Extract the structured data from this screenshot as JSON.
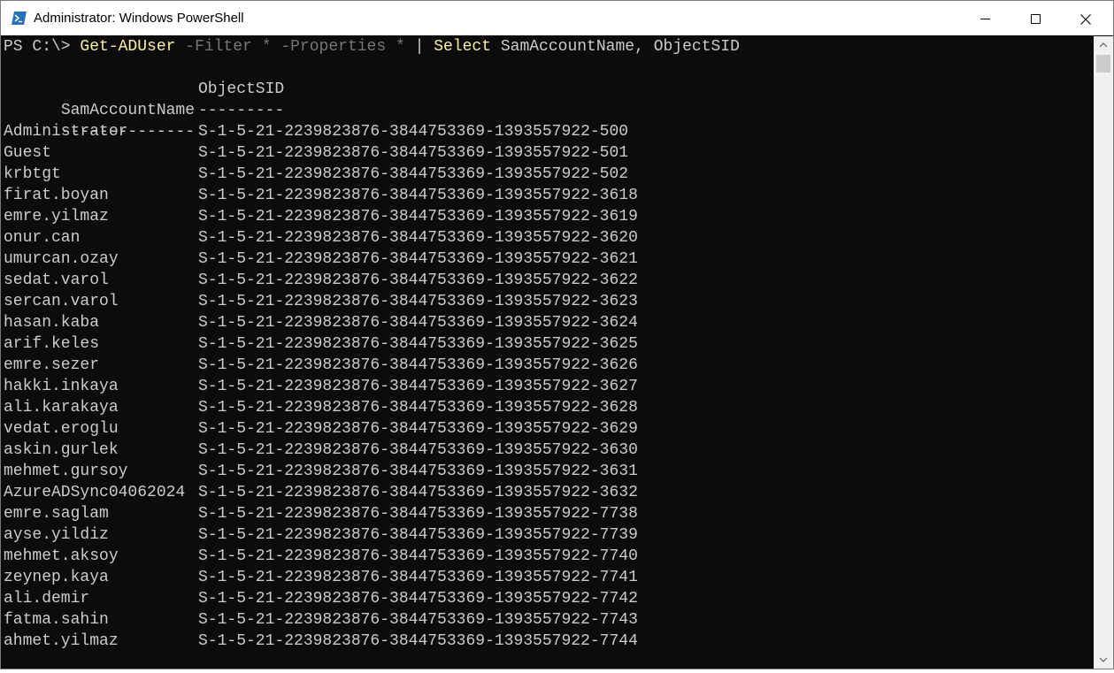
{
  "window": {
    "title": "Administrator: Windows PowerShell",
    "accent_color": "#012456",
    "console_bg": "#0c0c0c",
    "console_fg": "#cccccc",
    "command_color": "#f9f1a5",
    "parameter_color": "#767676"
  },
  "controls": {
    "minimize_icon": "minimize-icon",
    "maximize_icon": "maximize-icon",
    "close_icon": "close-icon"
  },
  "command_line": {
    "prompt": "PS C:\\> ",
    "cmdlet": "Get-ADUser",
    "param_filter": "-Filter",
    "filter_value": "*",
    "param_properties": "-Properties",
    "properties_value": "*",
    "pipe": "|",
    "select_cmd": "Select",
    "select_args": "SamAccountName,",
    "select_args2": "ObjectSID"
  },
  "table": {
    "headers": [
      "SamAccountName",
      "ObjectSID"
    ],
    "separators": [
      "--------------",
      "---------"
    ],
    "rows": [
      [
        "Administrator",
        "S-1-5-21-2239823876-3844753369-1393557922-500"
      ],
      [
        "Guest",
        "S-1-5-21-2239823876-3844753369-1393557922-501"
      ],
      [
        "krbtgt",
        "S-1-5-21-2239823876-3844753369-1393557922-502"
      ],
      [
        "firat.boyan",
        "S-1-5-21-2239823876-3844753369-1393557922-3618"
      ],
      [
        "emre.yilmaz",
        "S-1-5-21-2239823876-3844753369-1393557922-3619"
      ],
      [
        "onur.can",
        "S-1-5-21-2239823876-3844753369-1393557922-3620"
      ],
      [
        "umurcan.ozay",
        "S-1-5-21-2239823876-3844753369-1393557922-3621"
      ],
      [
        "sedat.varol",
        "S-1-5-21-2239823876-3844753369-1393557922-3622"
      ],
      [
        "sercan.varol",
        "S-1-5-21-2239823876-3844753369-1393557922-3623"
      ],
      [
        "hasan.kaba",
        "S-1-5-21-2239823876-3844753369-1393557922-3624"
      ],
      [
        "arif.keles",
        "S-1-5-21-2239823876-3844753369-1393557922-3625"
      ],
      [
        "emre.sezer",
        "S-1-5-21-2239823876-3844753369-1393557922-3626"
      ],
      [
        "hakki.inkaya",
        "S-1-5-21-2239823876-3844753369-1393557922-3627"
      ],
      [
        "ali.karakaya",
        "S-1-5-21-2239823876-3844753369-1393557922-3628"
      ],
      [
        "vedat.eroglu",
        "S-1-5-21-2239823876-3844753369-1393557922-3629"
      ],
      [
        "askin.gurlek",
        "S-1-5-21-2239823876-3844753369-1393557922-3630"
      ],
      [
        "mehmet.gursoy",
        "S-1-5-21-2239823876-3844753369-1393557922-3631"
      ],
      [
        "AzureADSync04062024",
        "S-1-5-21-2239823876-3844753369-1393557922-3632"
      ],
      [
        "emre.saglam",
        "S-1-5-21-2239823876-3844753369-1393557922-7738"
      ],
      [
        "ayse.yildiz",
        "S-1-5-21-2239823876-3844753369-1393557922-7739"
      ],
      [
        "mehmet.aksoy",
        "S-1-5-21-2239823876-3844753369-1393557922-7740"
      ],
      [
        "zeynep.kaya",
        "S-1-5-21-2239823876-3844753369-1393557922-7741"
      ],
      [
        "ali.demir",
        "S-1-5-21-2239823876-3844753369-1393557922-7742"
      ],
      [
        "fatma.sahin",
        "S-1-5-21-2239823876-3844753369-1393557922-7743"
      ],
      [
        "ahmet.yilmaz",
        "S-1-5-21-2239823876-3844753369-1393557922-7744"
      ]
    ]
  }
}
